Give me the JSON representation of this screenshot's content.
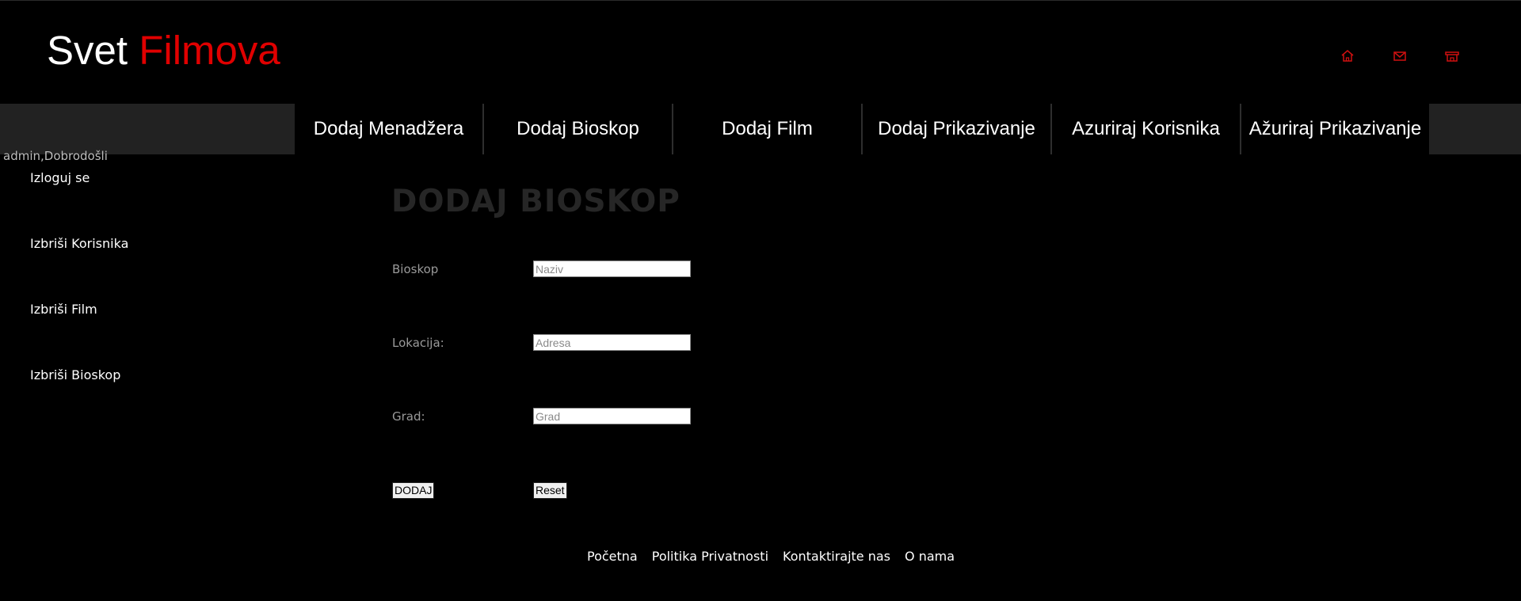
{
  "brand": {
    "word1": "Svet",
    "word2": "Filmova",
    "word2_color": "#e00000"
  },
  "header_icons": [
    "home-icon",
    "mail-icon",
    "store-icon"
  ],
  "nav": {
    "items": [
      "Dodaj Menadžera",
      "Dodaj Bioskop",
      "Dodaj Film",
      "Dodaj Prikazivanje",
      "Azuriraj Korisnika",
      "Ažuriraj Prikazivanje"
    ]
  },
  "user": {
    "welcome": "admin,Dobrodošli"
  },
  "sidebar": {
    "links": [
      "Izloguj se",
      "Izbriši Korisnika",
      "Izbriši Film",
      "Izbriši Bioskop"
    ]
  },
  "form": {
    "title": "DODAJ BIOSKOP",
    "fields": [
      {
        "label": "Bioskop",
        "placeholder": "Naziv",
        "value": ""
      },
      {
        "label": "Lokacija:",
        "placeholder": "Adresa",
        "value": ""
      },
      {
        "label": "Grad:",
        "placeholder": "Grad",
        "value": ""
      }
    ],
    "submit_label": "DODAJ",
    "reset_label": "Reset"
  },
  "footer": {
    "links": [
      "Početna",
      "Politika Privatnosti",
      "Kontaktirajte nas",
      "O nama"
    ]
  }
}
